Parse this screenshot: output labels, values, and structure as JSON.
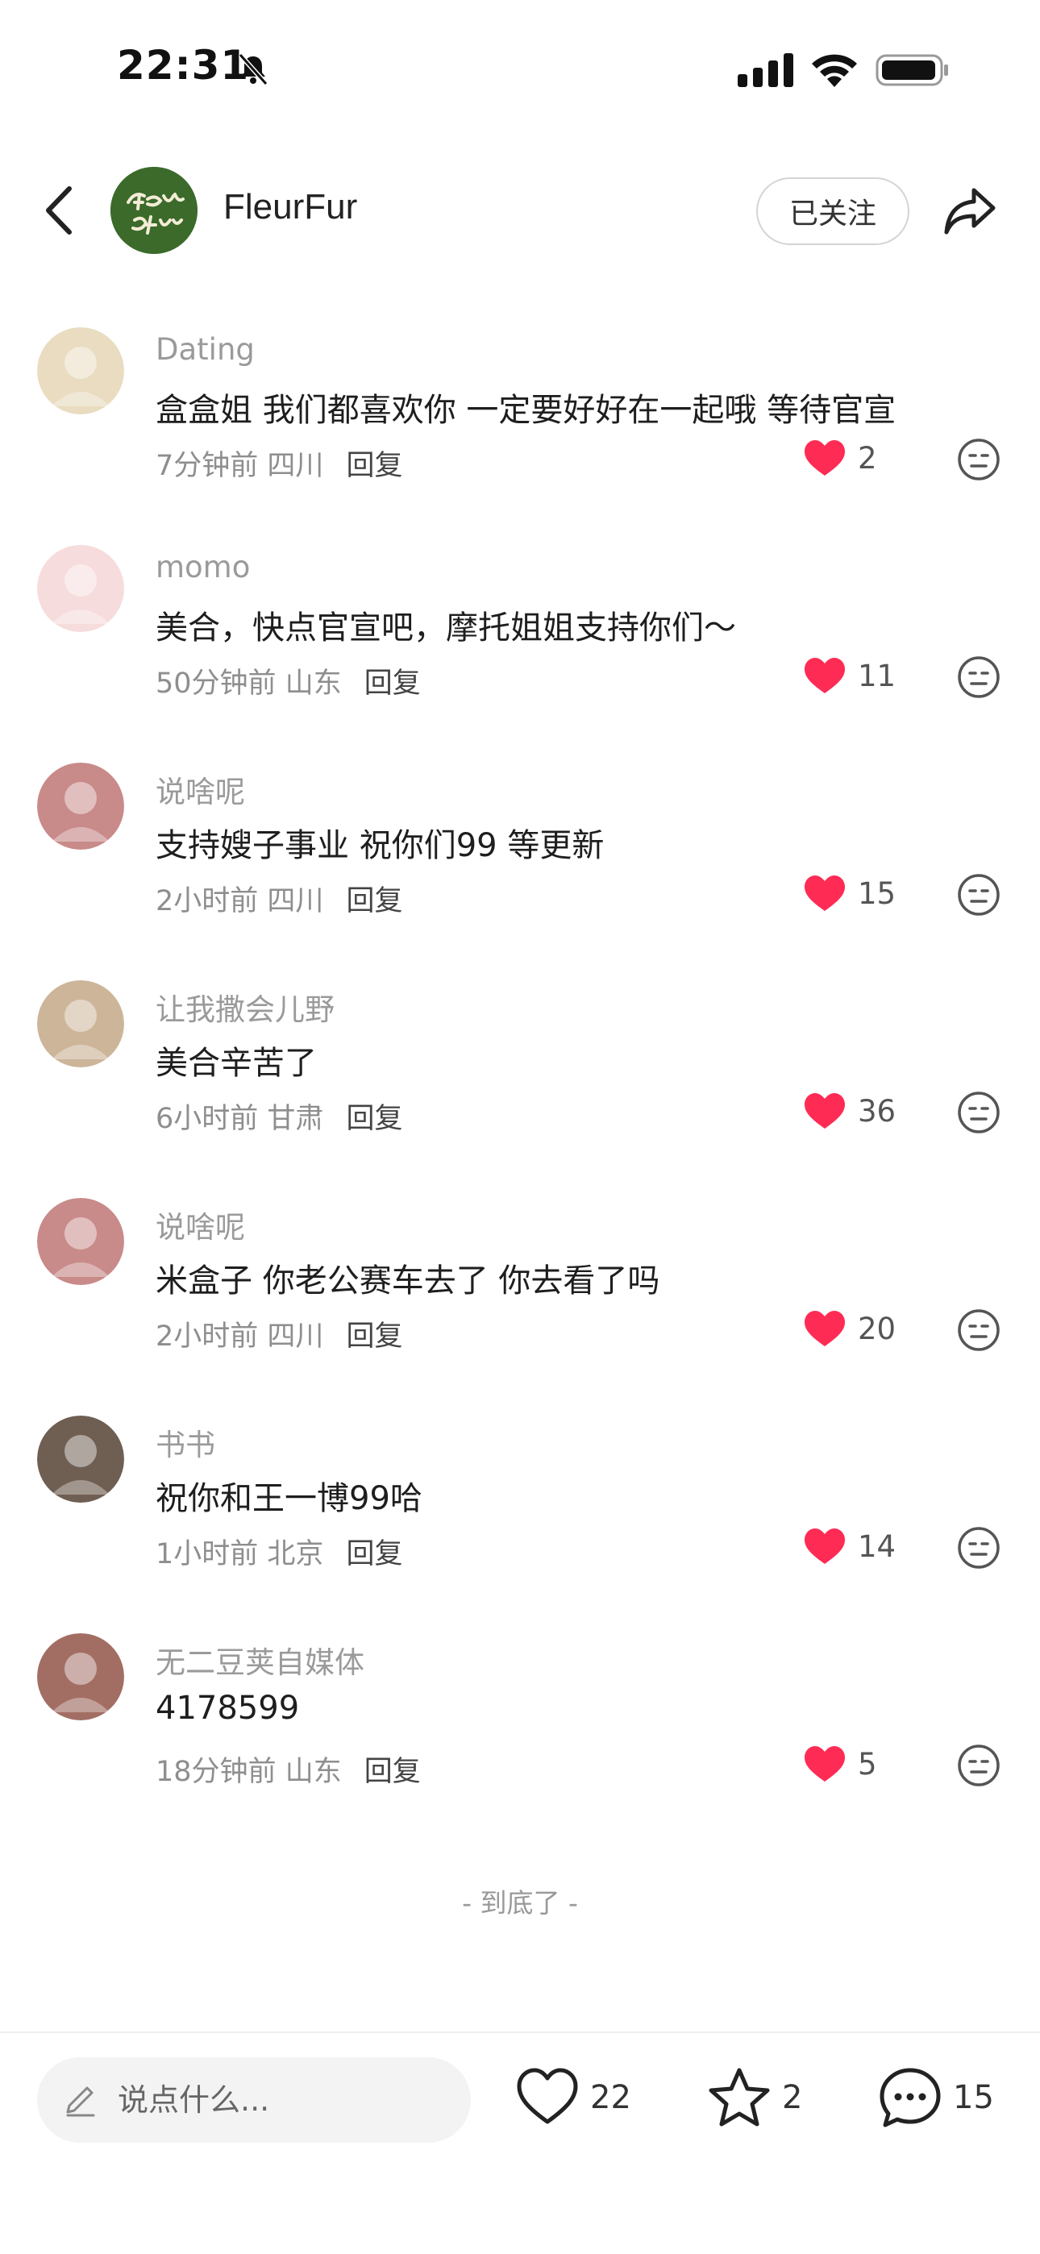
{
  "status_bar": {
    "time": "22:31"
  },
  "header": {
    "account_name": "FleurFur",
    "follow_label": "已关注"
  },
  "comments": [
    {
      "user": "Dating",
      "text": "盒盒姐 我们都喜欢你 一定要好好在一起哦 等待官宣",
      "time": "7分钟前",
      "location": "四川",
      "reply": "回复",
      "likes": "2",
      "avatar_color": "#e9dcc0"
    },
    {
      "user": "momo",
      "text": "美合，快点官宣吧，摩托姐姐支持你们～",
      "time": "50分钟前",
      "location": "山东",
      "reply": "回复",
      "likes": "11",
      "avatar_color": "#f6dcdc"
    },
    {
      "user": "说啥呢",
      "text": "支持嫂子事业 祝你们99 等更新",
      "time": "2小时前",
      "location": "四川",
      "reply": "回复",
      "likes": "15",
      "avatar_color": "#c98a8a"
    },
    {
      "user": "让我撒会儿野",
      "text": "美合辛苦了",
      "time": "6小时前",
      "location": "甘肃",
      "reply": "回复",
      "likes": "36",
      "avatar_color": "#cdb59a"
    },
    {
      "user": "说啥呢",
      "text": "米盒子 你老公赛车去了 你去看了吗",
      "time": "2小时前",
      "location": "四川",
      "reply": "回复",
      "likes": "20",
      "avatar_color": "#c98a8a"
    },
    {
      "user": "书书",
      "text": "祝你和王一博99哈",
      "time": "1小时前",
      "location": "北京",
      "reply": "回复",
      "likes": "14",
      "avatar_color": "#6f5e52"
    },
    {
      "user": "无二豆荚自媒体",
      "text": "4178599",
      "time": "18分钟前",
      "location": "山东",
      "reply": "回复",
      "likes": "5",
      "avatar_color": "#a26e64"
    }
  ],
  "end_marker": "- 到底了 -",
  "bottom_bar": {
    "input_placeholder": "说点什么...",
    "likes": "22",
    "favorites": "2",
    "comments": "15"
  },
  "colors": {
    "like_red": "#fe2c55",
    "brand_green": "#3b6a2a"
  }
}
